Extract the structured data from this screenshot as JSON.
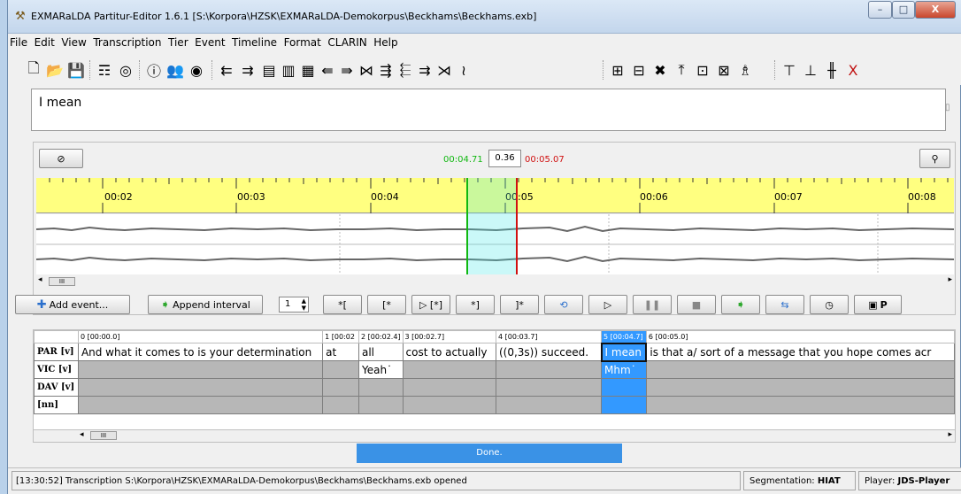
{
  "window": {
    "title": "EXMARaLDA Partitur-Editor 1.6.1 [S:\\Korpora\\HZSK\\EXMARaLDA-Demokorpus\\Beckhams\\Beckhams.exb]",
    "minimize": "–",
    "maximize": "□",
    "close": "X"
  },
  "menu": [
    "File",
    "Edit",
    "View",
    "Transcription",
    "Tier",
    "Event",
    "Timeline",
    "Format",
    "CLARIN",
    "Help"
  ],
  "editor": {
    "text": "I mean"
  },
  "timeline": {
    "start_time": "00:04.71",
    "duration": "0.36",
    "end_time": "00:05.07",
    "ticks": [
      "00:02",
      "00:03",
      "00:04",
      "00:05",
      "00:06",
      "00:07",
      "00:08"
    ],
    "scroll_label": "III"
  },
  "controls": {
    "add_event": "Add event...",
    "append_interval": "Append interval",
    "spinner_value": "1",
    "b1": "*[",
    "b2": "[*",
    "b3": "▷ [*]",
    "b4": "*]",
    "b5": "]*",
    "b_last": "P"
  },
  "table": {
    "headers": [
      "0 [00:00.0]",
      "1 [00:02",
      "2 [00:02.4]",
      "3 [00:02.7]",
      "4 [00:03.7]",
      "5 [00:04.7]",
      "6 [00:05.0]"
    ],
    "tiers": [
      {
        "name": "PAR [v]",
        "cells": [
          "And what it comes to is your determination",
          "at",
          "all",
          "cost to actually",
          "((0,3s)) succeed.",
          "I mean",
          "is that a/ sort of a message that you hope comes acr"
        ]
      },
      {
        "name": "VIC [v]",
        "cells": [
          "",
          "",
          "Yeah˙",
          "",
          "",
          "Mhm˙",
          ""
        ]
      },
      {
        "name": "DAV [v]",
        "cells": [
          "",
          "",
          "",
          "",
          "",
          "",
          ""
        ]
      },
      {
        "name": "[nn]",
        "cells": [
          "",
          "",
          "",
          "",
          "",
          "",
          ""
        ]
      }
    ],
    "scroll_label": "III"
  },
  "progress": {
    "text": "Done."
  },
  "status": {
    "message": "[13:30:52] Transcription S:\\Korpora\\HZSK\\EXMARaLDA-Demokorpus\\Beckhams\\Beckhams.exb opened",
    "segmentation_label": "Segmentation:",
    "segmentation_value": "HIAT",
    "player_label": "Player:",
    "player_value": "JDS-Player"
  }
}
